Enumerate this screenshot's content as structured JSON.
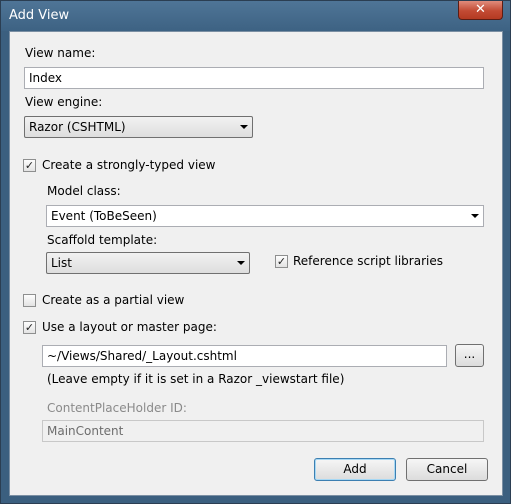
{
  "window": {
    "title": "Add View",
    "close_glyph": "✕"
  },
  "view_name": {
    "label": "View name:",
    "value": "Index"
  },
  "view_engine": {
    "label": "View engine:",
    "selected": "Razor (CSHTML)"
  },
  "strongly_typed": {
    "label": "Create a strongly-typed view",
    "checked": true
  },
  "model_class": {
    "label": "Model class:",
    "selected": "Event (ToBeSeen)"
  },
  "scaffold_template": {
    "label": "Scaffold template:",
    "selected": "List"
  },
  "reference_scripts": {
    "label": "Reference script libraries",
    "checked": true
  },
  "partial_view": {
    "label": "Create as a partial view",
    "checked": false
  },
  "layout": {
    "label": "Use a layout or master page:",
    "checked": true,
    "value": "~/Views/Shared/_Layout.cshtml",
    "browse_label": "...",
    "hint": "(Leave empty if it is set in a Razor _viewstart file)"
  },
  "placeholder": {
    "label": "ContentPlaceHolder ID:",
    "value": "MainContent"
  },
  "buttons": {
    "add": "Add",
    "cancel": "Cancel"
  },
  "check_glyph": "✓"
}
